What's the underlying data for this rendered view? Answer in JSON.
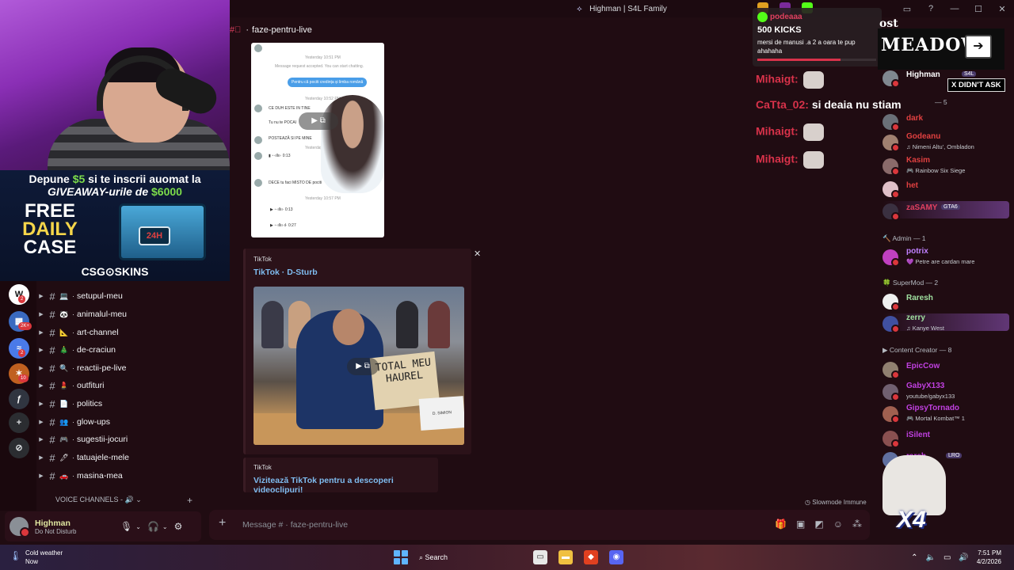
{
  "window": {
    "title": "Highman | S4L Family",
    "controls": [
      "—",
      "☐",
      "✕"
    ]
  },
  "channel_header": {
    "name": "faze-pentru-live"
  },
  "stream": {
    "promo_line1_pre": "Depune ",
    "promo_line1_amount": "$5",
    "promo_line1_post": " si te inscrii auomat la",
    "promo_line2_pre": "GIVEAWAY-urile de ",
    "promo_line2_amount": "$6000",
    "promo_free": "FREE",
    "promo_daily": "DAILY",
    "promo_case": "CASE",
    "promo_chest_label": "24H",
    "promo_brand": "CSG⊙SKINS",
    "kick_user": "podeaaa",
    "kick_amount": "500 KICKS",
    "kick_note": "mersi de manusi .a 2 a oara te pup ahahaha",
    "kick_progress": 0.7,
    "meadow_top": "ost",
    "meadow_word": "MEADOW",
    "meadow_arrow": "➔",
    "x_didnt_ask": "X DIDN'T ASK",
    "chat": [
      {
        "user": "Mihaigt:",
        "msg": ""
      },
      {
        "user": "CaTta_02:",
        "msg": "si deaia nu stiam"
      },
      {
        "user": "Mihaigt:",
        "msg": ""
      },
      {
        "user": "Mihaigt:",
        "msg": ""
      }
    ],
    "x4": "X4"
  },
  "channels": [
    {
      "emoji": "💻",
      "name": "setupul-meu"
    },
    {
      "emoji": "🐼",
      "name": "animalul-meu"
    },
    {
      "emoji": "📐",
      "name": "art-channel"
    },
    {
      "emoji": "🎄",
      "name": "de-craciun"
    },
    {
      "emoji": "🔍",
      "name": "reactii-pe-live"
    },
    {
      "emoji": "💄",
      "name": "outfituri"
    },
    {
      "emoji": "📄",
      "name": "politics"
    },
    {
      "emoji": "👥",
      "name": "glow-ups"
    },
    {
      "emoji": "🎮",
      "name": "sugestii-jocuri"
    },
    {
      "emoji": "🖊",
      "name": "tatuajele-mele"
    },
    {
      "emoji": "🚗",
      "name": "masina-mea"
    }
  ],
  "voice_header": "VOICE CHANNELS - 🔊",
  "rail_badges": {
    "b1": "2",
    "b2": "2K+",
    "b3": "2",
    "b4": "10"
  },
  "user_panel": {
    "name": "Highman",
    "status": "Do Not Disturb"
  },
  "chat_screenshot": {
    "lines": [
      "Yesterday 10:51 PM",
      "Message request accepted. You can start chatting.",
      "Pentru că pociti credința și limba română",
      "Yesterday 10:52 PM",
      "CE DUH ESTE IN TINE",
      "Tu nu te POCAI",
      "POSTEAZĂ SI PE MINE",
      "Yesterday 10:53 PM",
      "0:13",
      "DECE tu faci MISTO DE pociti",
      "Yesterday 10:57 PM",
      "0:13",
      "0:27"
    ]
  },
  "embed": {
    "provider": "TikTok",
    "title": "TikTok · D-Sturb",
    "sign_text": "TOTAL MEU HAUREL",
    "nameplate": "D. SIMION",
    "close": "✕"
  },
  "embed2": {
    "provider": "TikTok",
    "title": "Vizitează TikTok pentru a descoperi videoclipuri!"
  },
  "slowmode": "Slowmode Immune",
  "composer": {
    "placeholder": "Message # · faze-pentru-live"
  },
  "members": {
    "top_row": {
      "name": "Highman",
      "sub": "S4L"
    },
    "group_partial": "— 5",
    "rows1": [
      {
        "name": "dark",
        "sub": "",
        "color": "#e04040",
        "av": "#6a7078"
      },
      {
        "name": "Godeanu",
        "sub": "♫ Nimeni Altu', Ombladon",
        "color": "#e04040",
        "av": "#a08070"
      },
      {
        "name": "Kasim",
        "sub": "🎮 Rainbow Six Siege",
        "color": "#e04040",
        "av": "#8a6a6a"
      },
      {
        "name": "het",
        "sub": "",
        "color": "#e04040",
        "av": "#e0c0c8"
      },
      {
        "name": "zaSAMY",
        "sub": "",
        "color": "#e04060",
        "av": "#3a3040",
        "tag": "GTA6"
      }
    ],
    "admin_header": "Admin — 1",
    "admin": [
      {
        "name": "potrix",
        "sub": "💜 Petre are cardan mare",
        "color": "#c080ff",
        "av": "#c040c0"
      }
    ],
    "supermod_header": "SuperMod — 2",
    "supermod": [
      {
        "name": "Raresh",
        "sub": "",
        "color": "#a0e0a0",
        "av": "#f0f0f0"
      },
      {
        "name": "zerry",
        "sub": "♫ Kanye West",
        "color": "#a0e0a0",
        "av": "#4050a0"
      }
    ],
    "cc_header": "Content Creator — 8",
    "cc": [
      {
        "name": "EpicCow",
        "sub": "",
        "color": "#c040e0",
        "av": "#908070"
      },
      {
        "name": "GabyX133",
        "sub": "youtube/gabyx133",
        "color": "#c040e0",
        "av": "#706070"
      },
      {
        "name": "GipsyTornado",
        "sub": "🎮 Mortal Kombat™ 1",
        "color": "#c040e0",
        "av": "#a06050"
      },
      {
        "name": "iSilent",
        "sub": "",
        "color": "#c040e0",
        "av": "#8a5050"
      },
      {
        "name": "rareh",
        "sub": "",
        "color": "#c040e0",
        "av": "#6070a0",
        "tag": "LRO"
      }
    ]
  },
  "taskbar": {
    "weather_title": "Cold weather",
    "weather_sub": "Now",
    "search": "Search",
    "time": "7:51 PM",
    "date": "4/2/2026"
  }
}
